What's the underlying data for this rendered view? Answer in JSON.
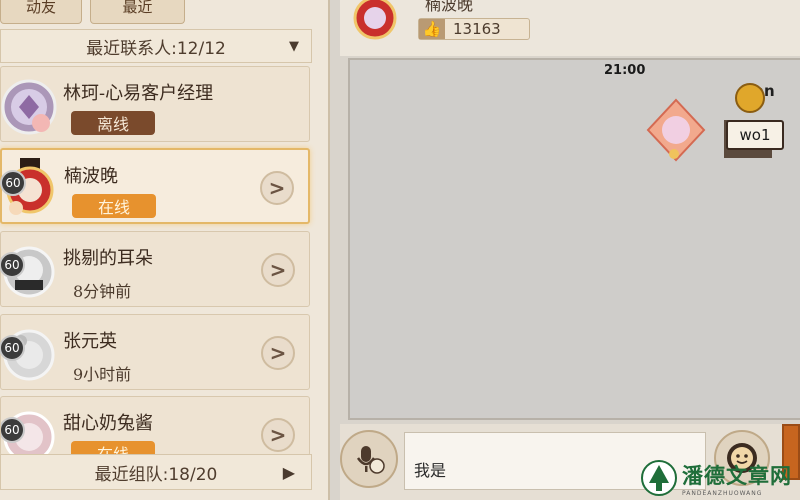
{
  "top_tabs": [
    "动友",
    "最近"
  ],
  "recent_contacts_header": {
    "label": "最近联系人:12/12"
  },
  "contacts": [
    {
      "name": "林珂-心易客户经理",
      "status": "离线",
      "status_type": "offline",
      "level": ""
    },
    {
      "name": "楠波晚",
      "status": "在线",
      "status_type": "online",
      "level": "60",
      "selected": true
    },
    {
      "name": "挑剔的耳朵",
      "time": "8分钟前",
      "level": "60"
    },
    {
      "name": "张元英",
      "time": "9小时前",
      "level": "60"
    },
    {
      "name": "甜心奶兔酱",
      "status": "在线",
      "status_type": "online",
      "level": "60"
    }
  ],
  "team_header": {
    "label": "最近组队:18/20"
  },
  "chat_header": {
    "name": "楠波晚",
    "likes": "13163"
  },
  "chat": {
    "timestamp": "21:00",
    "sender_name": "fran",
    "message": "wo1"
  },
  "input": {
    "value": "我是"
  },
  "watermark": {
    "main": "潘德文章网",
    "sub": "PANDEANZHUOWANG"
  },
  "colors": {
    "online": "#e7922e",
    "offline": "#7a4a2c",
    "selected_border": "#e4b868"
  }
}
